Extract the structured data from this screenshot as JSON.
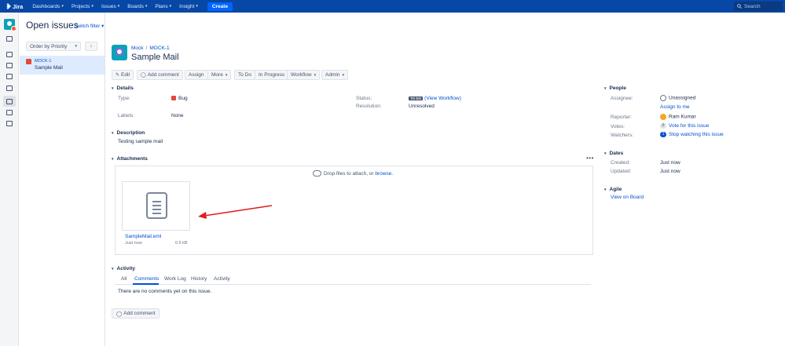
{
  "topnav": {
    "brand": "Jira",
    "items": [
      "Dashboards",
      "Projects",
      "Issues",
      "Boards",
      "Plans",
      "Insight"
    ],
    "create_label": "Create",
    "search_placeholder": "Search"
  },
  "filter": {
    "title": "Open issues",
    "switch_label": "Switch filter",
    "order_by": "Order by Priority",
    "sort_direction": "↓"
  },
  "issue_list": [
    {
      "key": "MOCK-1",
      "summary": "Sample Mail"
    }
  ],
  "issue": {
    "project": "Mock",
    "key": "MOCK-1",
    "summary": "Sample Mail"
  },
  "toolbar": {
    "edit": "Edit",
    "add_comment": "Add comment",
    "assign": "Assign",
    "more": "More",
    "to_do": "To Do",
    "in_progress": "In Progress",
    "workflow": "Workflow",
    "admin": "Admin"
  },
  "details": {
    "heading": "Details",
    "type_label": "Type:",
    "type_value": "Bug",
    "labels_label": "Labels:",
    "labels_value": "None",
    "status_label": "Status:",
    "status_value": "TO DO",
    "view_workflow": "(View Workflow)",
    "resolution_label": "Resolution:",
    "resolution_value": "Unresolved"
  },
  "description": {
    "heading": "Description",
    "text": "Testing sample mail"
  },
  "attachments": {
    "heading": "Attachments",
    "drop_text": "Drop files to attach, or",
    "browse": "browse.",
    "more": "•••",
    "file_name": "SampleMail.eml",
    "file_when": "Just now",
    "file_size": "0.5 kB"
  },
  "activity": {
    "heading": "Activity",
    "tabs": [
      "All",
      "Comments",
      "Work Log",
      "History",
      "Activity"
    ],
    "active_tab": "Comments",
    "empty_text": "There are no comments yet on this issue.",
    "add_comment": "Add comment"
  },
  "people": {
    "heading": "People",
    "assignee_label": "Assignee:",
    "assignee_value": "Unassigned",
    "assign_to_me": "Assign to me",
    "reporter_label": "Reporter:",
    "reporter_value": "Ram Kumar",
    "votes_label": "Votes:",
    "votes_count": "0",
    "vote_link": "Vote for this issue",
    "watchers_label": "Watchers:",
    "watchers_count": "1",
    "watch_link": "Stop watching this issue"
  },
  "dates": {
    "heading": "Dates",
    "created_label": "Created:",
    "created_value": "Just now",
    "updated_label": "Updated:",
    "updated_value": "Just now"
  },
  "agile": {
    "heading": "Agile",
    "view_on_board": "View on Board"
  },
  "colors": {
    "nav": "#0747a6",
    "link": "#0052cc",
    "bug": "#e5493a",
    "arrow": "#e11d1d"
  }
}
